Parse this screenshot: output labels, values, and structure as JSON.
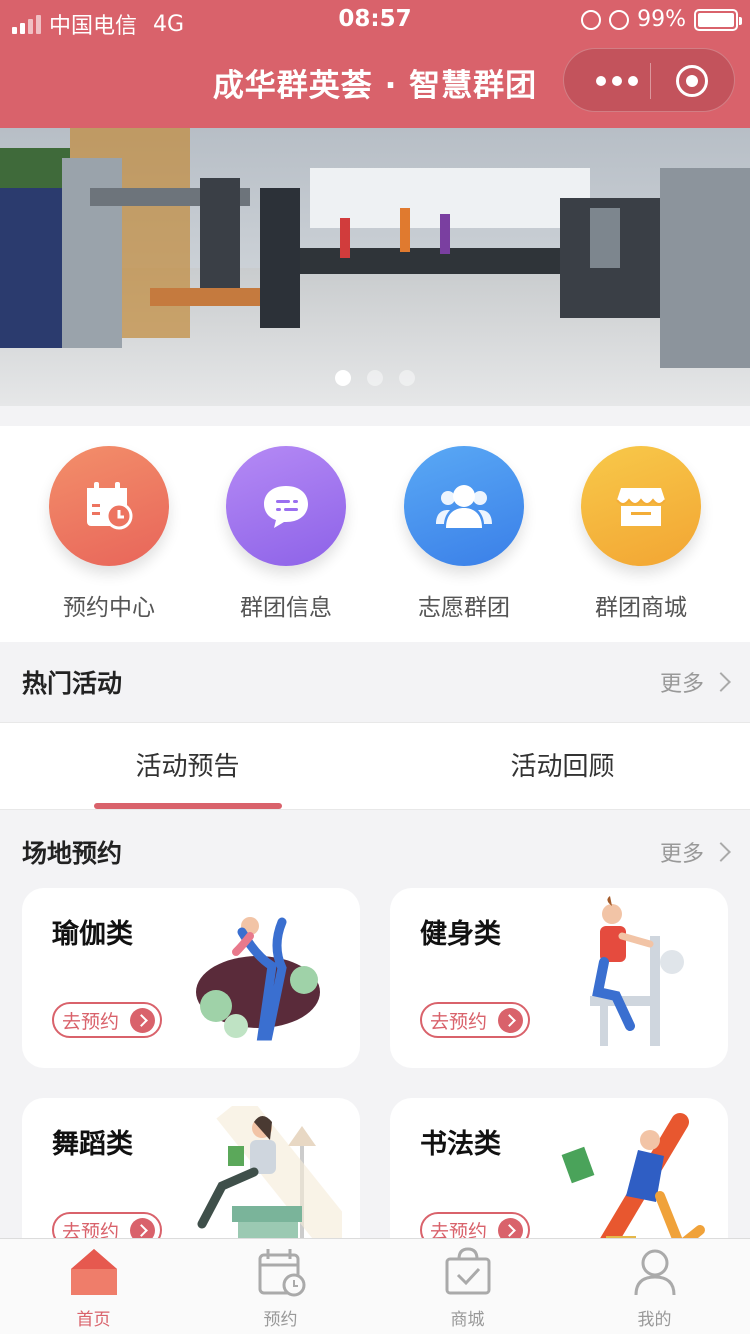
{
  "status_bar": {
    "carrier": "中国电信",
    "network": "4G",
    "time": "08:57",
    "battery": "99%"
  },
  "nav": {
    "title": "成华群英荟 · 智慧群团"
  },
  "banner": {
    "slides": 3,
    "active_slide": 0
  },
  "quick_entries": [
    {
      "label": "预约中心",
      "icon": "calendar-clock-icon",
      "color": "#ef7a5f"
    },
    {
      "label": "群团信息",
      "icon": "chat-bubble-icon",
      "color": "#9a6ff0"
    },
    {
      "label": "志愿群团",
      "icon": "people-icon",
      "color": "#3f8df0"
    },
    {
      "label": "群团商城",
      "icon": "store-icon",
      "color": "#f5b23a"
    }
  ],
  "hot_activities": {
    "title": "热门活动",
    "more": "更多"
  },
  "activity_tabs": [
    {
      "label": "活动预告",
      "active": true
    },
    {
      "label": "活动回顾",
      "active": false
    }
  ],
  "venue_booking": {
    "title": "场地预约",
    "more": "更多",
    "cards": [
      {
        "title": "瑜伽类",
        "button": "去预约",
        "art": "yoga-illustration"
      },
      {
        "title": "健身类",
        "button": "去预约",
        "art": "fitness-illustration"
      },
      {
        "title": "舞蹈类",
        "button": "去预约",
        "art": "dance-illustration"
      },
      {
        "title": "书法类",
        "button": "去预约",
        "art": "calligraphy-illustration"
      }
    ]
  },
  "tabbar": [
    {
      "label": "首页",
      "icon": "home-icon",
      "active": true
    },
    {
      "label": "预约",
      "icon": "calendar-icon",
      "active": false
    },
    {
      "label": "商城",
      "icon": "shopping-bag-icon",
      "active": false
    },
    {
      "label": "我的",
      "icon": "user-icon",
      "active": false
    }
  ],
  "colors": {
    "primary": "#d9626b",
    "muted": "#999999"
  }
}
